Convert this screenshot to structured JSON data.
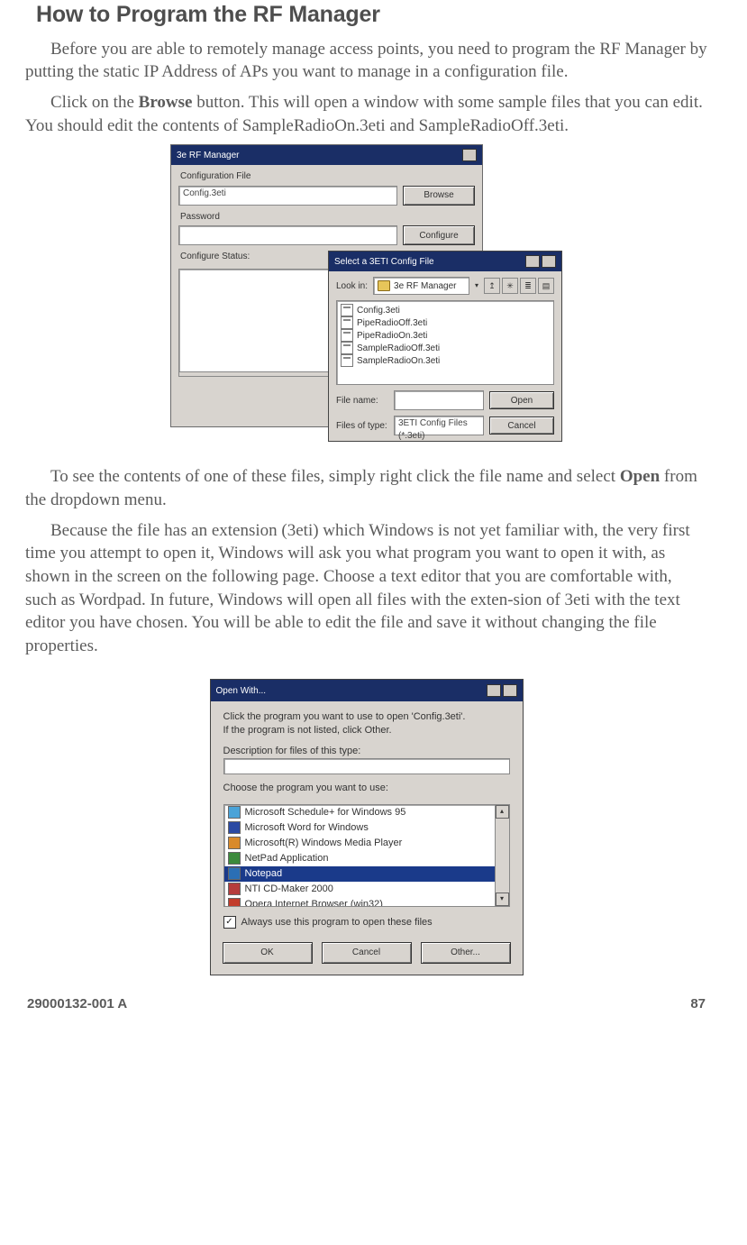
{
  "heading": "How to Program the RF Manager",
  "para1": "Before you are able to remotely manage access points, you need to program the RF Manager by putting the static IP Address of APs you want to manage in a configuration file.",
  "para2a": "Click on the ",
  "para2b": "Browse",
  "para2c": " button. This will open a window with some sample files that you can edit. You should edit the contents of SampleRadioOn.3eti and SampleRadioOff.3eti.",
  "para3a": "To see the contents of one of these files, simply right click the file name and select ",
  "para3b": "Open",
  "para3c": " from the dropdown menu.",
  "para4": "Because the file has an extension (3eti) which Windows is not yet familiar with, the very first time you attempt to open it, Windows will ask you what program you want to open it with, as shown in the screen on the following page. Choose a text editor that you are comfortable with, such as Wordpad. In future, Windows will open all files with the exten-sion of 3eti with the text editor you have chosen. You will be able to edit the file and save it without changing the file properties.",
  "footer_doc": "29000132-001 A",
  "footer_page": "87",
  "fig1": {
    "main_title": "3e RF Manager",
    "label_cfg": "Configuration File",
    "value_cfg": "Config.3eti",
    "btn_browse": "Browse",
    "label_pw": "Password",
    "btn_configure": "Configure",
    "label_status": "Configure Status:",
    "dlg_title": "Select a 3ETI Config File",
    "lookin_label": "Look in:",
    "lookin_value": "3e RF Manager",
    "files": [
      "Config.3eti",
      "PipeRadioOff.3eti",
      "PipeRadioOn.3eti",
      "SampleRadioOff.3eti",
      "SampleRadioOn.3eti"
    ],
    "fname_label": "File name:",
    "ftype_label": "Files of type:",
    "ftype_value": "3ETI Config Files (*.3eti)",
    "btn_open": "Open",
    "btn_cancel": "Cancel"
  },
  "fig2": {
    "title": "Open With...",
    "msg1": "Click the program you want to use to open 'Config.3eti'.",
    "msg2": "If the program is not listed, click Other.",
    "desc_label": "Description for files of this type:",
    "choose_label": "Choose the program you want to use:",
    "programs": [
      {
        "name": "Microsoft Schedule+ for Windows 95",
        "color": "#4aa3d8"
      },
      {
        "name": "Microsoft Word for Windows",
        "color": "#2b4aa3"
      },
      {
        "name": "Microsoft(R) Windows Media Player",
        "color": "#d98a2b"
      },
      {
        "name": "NetPad Application",
        "color": "#3c8a3c"
      },
      {
        "name": "Notepad",
        "color": "#2b6fb5",
        "selected": true
      },
      {
        "name": "NTI CD-Maker 2000",
        "color": "#b53c3c"
      },
      {
        "name": "Opera Internet Browser (win32)",
        "color": "#c23c2b"
      }
    ],
    "always": "Always use this program to open these files",
    "btn_ok": "OK",
    "btn_cancel": "Cancel",
    "btn_other": "Other..."
  }
}
